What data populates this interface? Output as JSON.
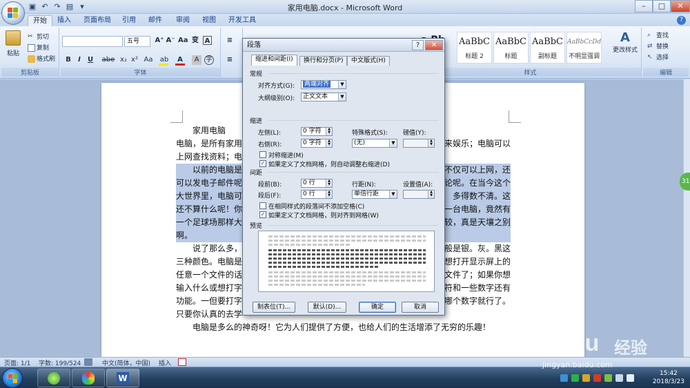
{
  "window": {
    "title": "家用电脑.docx - Microsoft Word",
    "controls": {
      "minimize": "–",
      "maximize": "□",
      "close": "✕"
    }
  },
  "ribbon_tabs": [
    "开始",
    "插入",
    "页面布局",
    "引用",
    "邮件",
    "审阅",
    "视图",
    "开发工具"
  ],
  "ribbon": {
    "clipboard": {
      "paste": "粘贴",
      "cut": "剪切",
      "copy": "复制",
      "format_painter": "格式刷",
      "label": "剪贴板"
    },
    "font": {
      "size": "五号",
      "label": "字体",
      "bold": "B",
      "italic": "I",
      "underline": "U",
      "strike": "abe",
      "sub": "x₂",
      "sup": "x²",
      "clear": "Aa",
      "grow": "A⁺",
      "shrink": "A⁻",
      "wen": "变",
      "highlight": "ab",
      "fontcolor": "A",
      "charbox": "A",
      "enclose": "字"
    },
    "styles": {
      "label": "样式",
      "tiles": [
        {
          "preview": "AaBbC",
          "name": "标题 2"
        },
        {
          "preview": "AaBbC",
          "name": "标题"
        },
        {
          "preview": "AaBbC",
          "name": "副标题"
        },
        {
          "preview": "AaBbCcDd",
          "name": "不明显强调"
        }
      ],
      "change_styles": "更改样式",
      "partial": "a Bb"
    },
    "editing": {
      "label": "编辑",
      "find": "查找",
      "replace": "替换",
      "select": "选择"
    },
    "colors": {
      "highlight": "#f2e600",
      "font": "#d21f1f"
    }
  },
  "document": {
    "lines": [
      {
        "text": "家用电脑",
        "indent": true,
        "selected": false
      },
      {
        "text": "电脑，是所有家用",
        "tail": "来娱乐；电脑可以",
        "selected": false
      },
      {
        "text": "上网查找资料；电",
        "selected": false
      },
      {
        "text": "以前的电脑是",
        "tail": "不仅可以上网，还",
        "indent": true,
        "selected": true
      },
      {
        "text": "可以发电子邮件呢",
        "tail": "论呢。在当今这个",
        "selected": true
      },
      {
        "text": "大世界里，电脑可",
        "tail": "多得数不清。这",
        "selected": true
      },
      {
        "text": "还不算什么呢！你",
        "tail": "一台电脑，竟然有",
        "selected": true
      },
      {
        "text": "一个足球场那样大",
        "tail": "较，真是天壤之别",
        "selected": true
      },
      {
        "text": "啊。",
        "selected": true
      },
      {
        "text": "说了那么多，",
        "tail": "般是银。灰。黑这",
        "indent": true,
        "selected": false
      },
      {
        "text": "三种颜色。电脑是",
        "tail": "想打开显示屏上的",
        "selected": false
      },
      {
        "text": "任意一个文件的话",
        "tail": "文件了；如果你想",
        "selected": false
      },
      {
        "text": "输入什么或想打字",
        "tail": "符和一些数字还有",
        "selected": false
      },
      {
        "text": "功能。一但要打字",
        "tail": "哪个数字就行了。",
        "selected": false
      },
      {
        "text": "只要你认真的去学",
        "selected": false
      },
      {
        "text": "电脑是多么的神奇呀！它为人们提供了方便，也给人们的生活增添了无穷的乐趣！",
        "indent": true,
        "selected": false
      }
    ],
    "side_badge": "31"
  },
  "dialog": {
    "title": "段落",
    "help": "?",
    "close": "✕",
    "tabs": [
      "缩进和间距(I)",
      "换行和分页(P)",
      "中文版式(H)"
    ],
    "general": {
      "header": "常规",
      "alignment_label": "对齐方式(G):",
      "alignment_value": "两端对齐",
      "outline_label": "大纲级别(O):",
      "outline_value": "正文文本"
    },
    "indent": {
      "header": "缩进",
      "left_label": "左侧(L):",
      "left_value": "0 字符",
      "right_label": "右侧(R):",
      "right_value": "0 字符",
      "special_label": "特殊格式(S):",
      "special_value": "(无)",
      "by_label": "磅值(Y):",
      "by_value": "",
      "mirror": "对称缩进(M)",
      "auto_adjust": "如果定义了文档网格，则自动调整右缩进(D)"
    },
    "spacing": {
      "header": "间距",
      "before_label": "段前(B):",
      "before_value": "0 行",
      "after_label": "段后(F):",
      "after_value": "0 行",
      "line_label": "行距(N):",
      "line_value": "单倍行距",
      "at_label": "设置值(A):",
      "at_value": "",
      "no_space": "在相同样式的段落间不添加空格(C)",
      "snap_grid": "如果定义了文档网格，则对齐到网格(W)"
    },
    "preview_header": "预览",
    "checks": {
      "mirror": false,
      "auto_adjust": true,
      "no_space": false,
      "snap_grid": true
    },
    "buttons": {
      "tabs": "制表位(T)...",
      "default": "默认(D)...",
      "ok": "确定",
      "cancel": "取消"
    }
  },
  "statusbar": {
    "page": "页面: 1/1",
    "words": "字数: 199/524",
    "language": "中文(简体，中国)",
    "mode": "插入"
  },
  "taskbar": {
    "time": "15:42",
    "date": "2018/3/23"
  },
  "watermark": {
    "brand": "Baidu",
    "brand_cn": "经验",
    "url": "jingyan.baidu.com"
  }
}
